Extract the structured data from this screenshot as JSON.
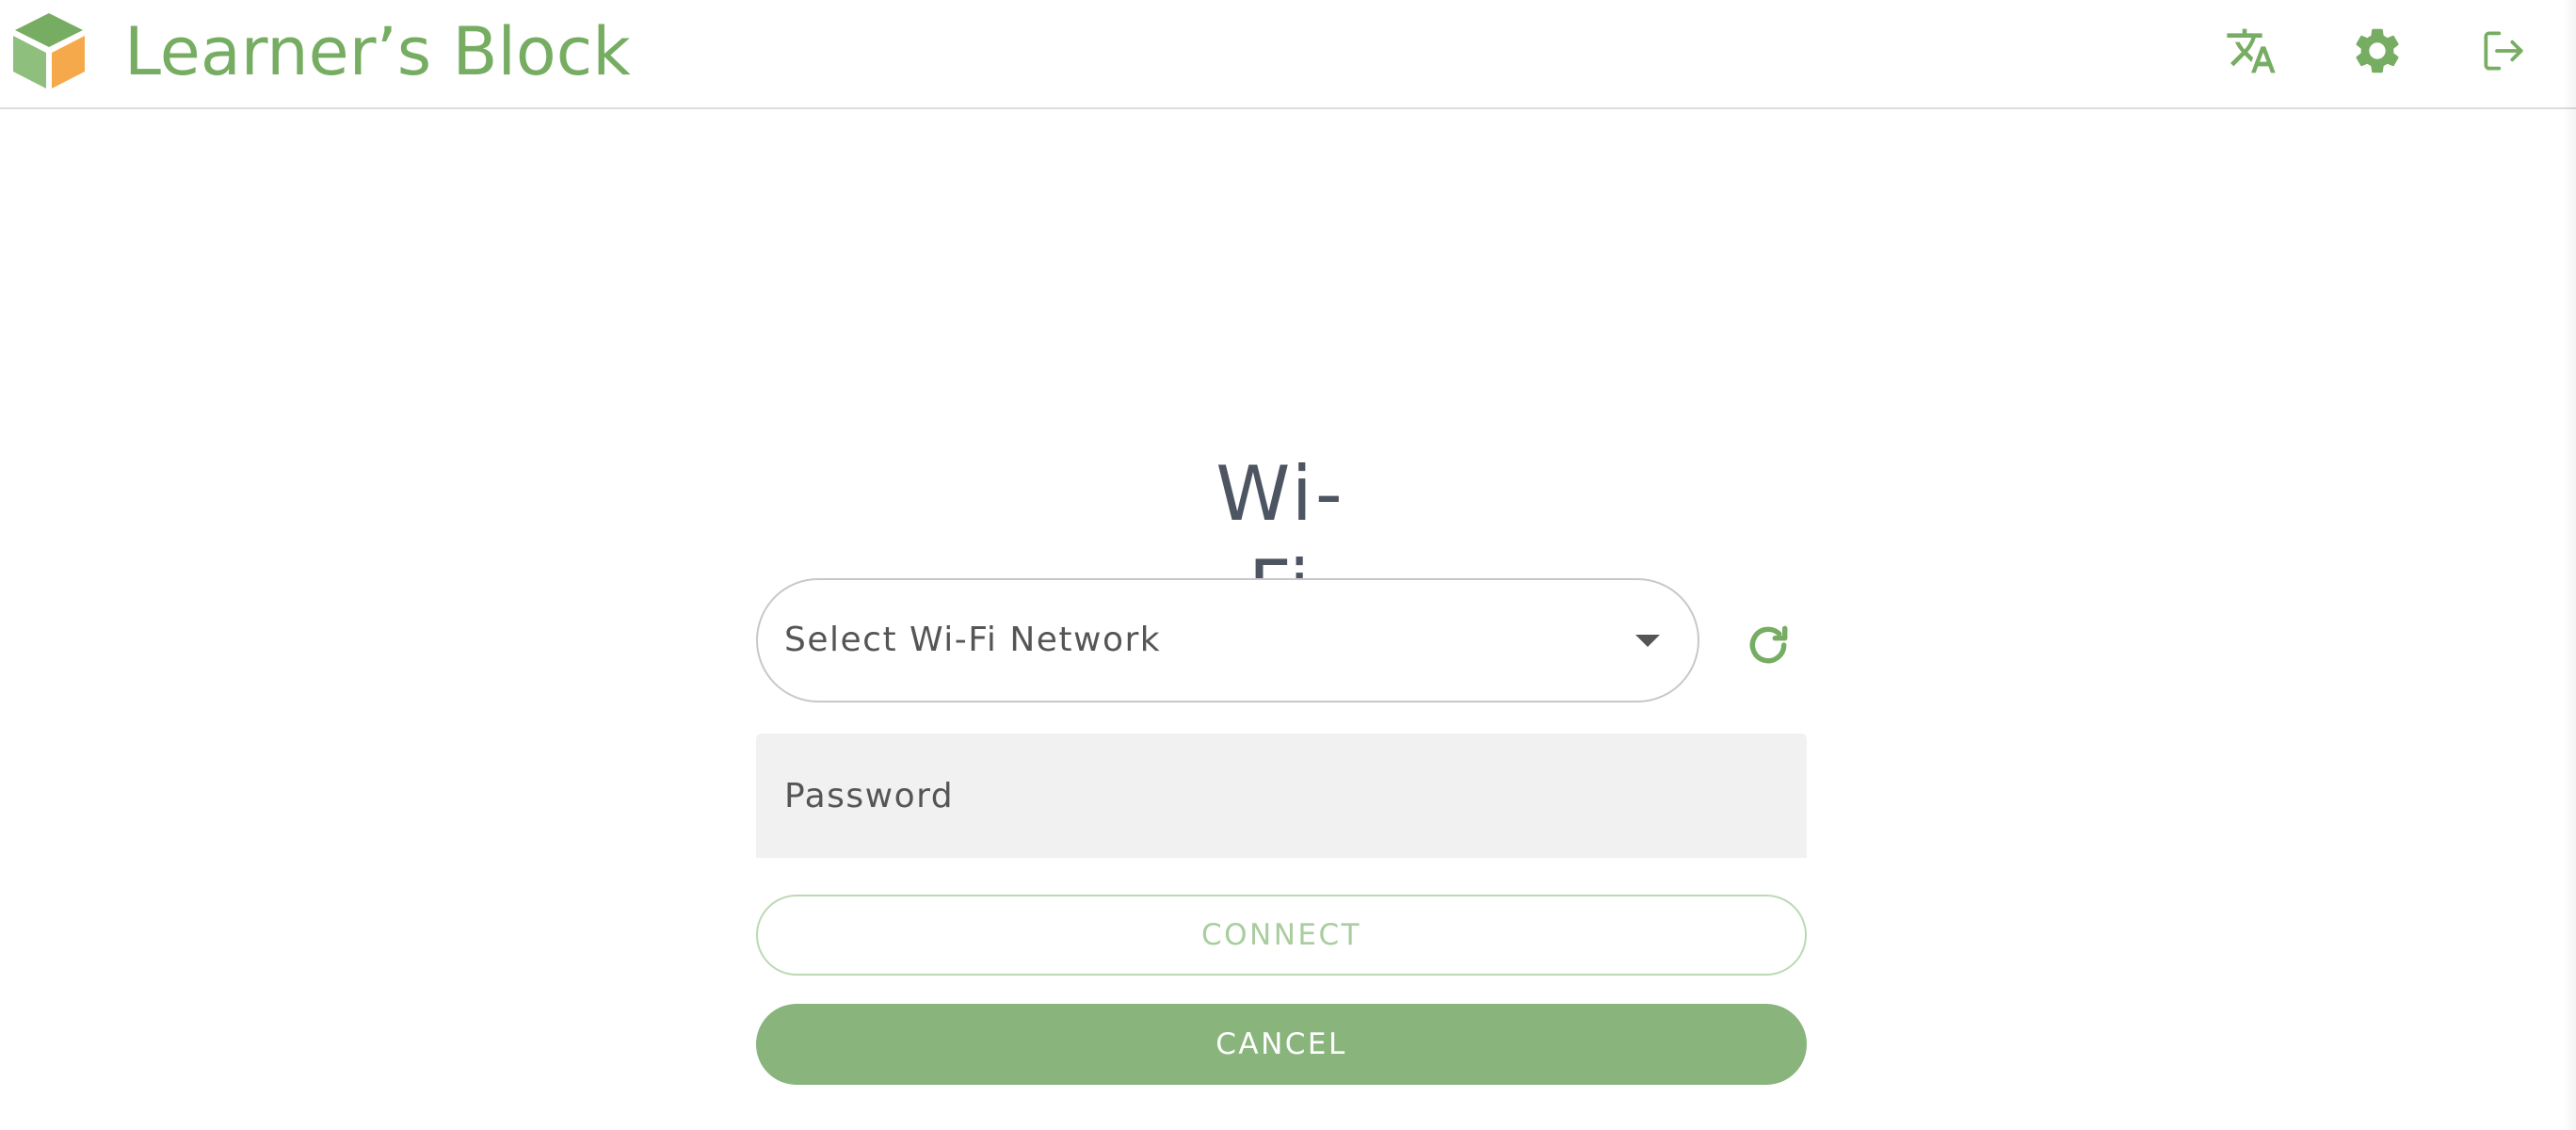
{
  "header": {
    "brand_name": "Learner’s Block",
    "logo_icon": "cube-logo",
    "translate_icon": "translate-icon",
    "settings_icon": "gear-icon",
    "logout_icon": "logout-icon"
  },
  "main": {
    "title": "Wi-Fi",
    "network_select": {
      "selected_value": "Select Wi-Fi Network",
      "caret_icon": "caret-down-icon"
    },
    "refresh_icon": "refresh-icon",
    "password": {
      "placeholder": "Password",
      "value": ""
    },
    "connect_label": "CONNECT",
    "cancel_label": "CANCEL"
  },
  "colors": {
    "brand_green": "#76ad62",
    "button_green": "#89b57c",
    "logo_orange": "#f5a94b",
    "title_gray": "#4d5562"
  }
}
